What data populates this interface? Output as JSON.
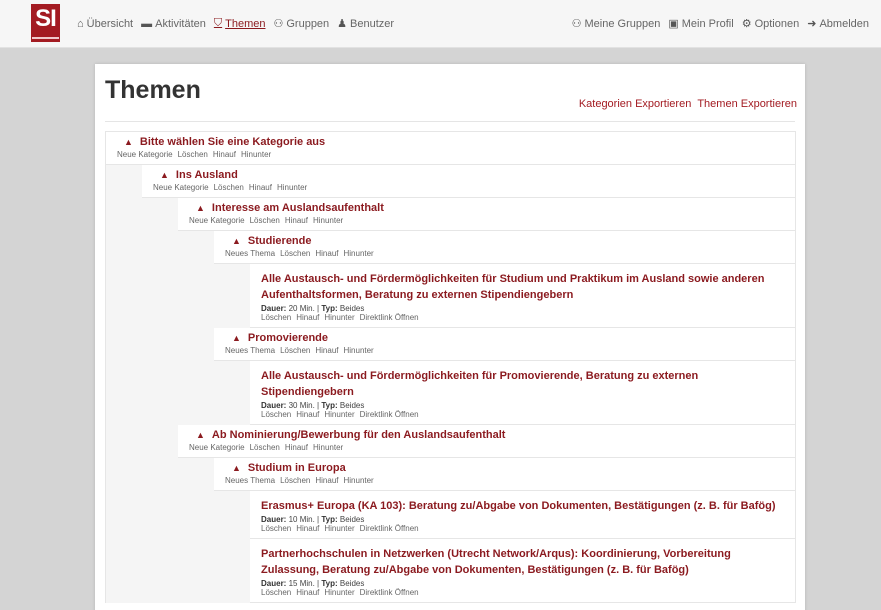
{
  "brand": {
    "logo_text": "SI"
  },
  "nav_left": [
    {
      "icon": "home-icon",
      "glyph": "⌂",
      "label": "Übersicht"
    },
    {
      "icon": "archive-icon",
      "glyph": "▬",
      "label": "Aktivitäten"
    },
    {
      "icon": "sitemap-icon",
      "glyph": "⛉",
      "label": "Themen",
      "active": true
    },
    {
      "icon": "users-icon",
      "glyph": "⚇",
      "label": "Gruppen"
    },
    {
      "icon": "user-icon",
      "glyph": "♟",
      "label": "Benutzer"
    }
  ],
  "nav_right": [
    {
      "icon": "group-icon",
      "glyph": "⚇",
      "label": "Meine Gruppen"
    },
    {
      "icon": "id-card-icon",
      "glyph": "▣",
      "label": "Mein Profil"
    },
    {
      "icon": "cogs-icon",
      "glyph": "⚙",
      "label": "Optionen"
    },
    {
      "icon": "sign-out-icon",
      "glyph": "➜",
      "label": "Abmelden"
    }
  ],
  "page": {
    "title": "Themen",
    "export_categories": "Kategorien Exportieren",
    "export_topics": "Themen Exportieren"
  },
  "labels": {
    "new_category": "Neue Kategorie",
    "new_topic": "Neues Thema",
    "delete": "Löschen",
    "up": "Hinauf",
    "down": "Hinunter",
    "direct_link": "Direktlink Öffnen",
    "duration": "Dauer:",
    "type": "Typ:"
  },
  "tree": [
    {
      "kind": "category",
      "level": 0,
      "title": "Bitte wählen Sie eine Kategorie aus",
      "new_label": "new_category"
    },
    {
      "kind": "category",
      "level": 1,
      "title": "Ins Ausland",
      "new_label": "new_category"
    },
    {
      "kind": "category",
      "level": 2,
      "title": "Interesse am Auslandsaufenthalt",
      "new_label": "new_category"
    },
    {
      "kind": "category",
      "level": 3,
      "title": "Studierende",
      "new_label": "new_topic"
    },
    {
      "kind": "topic",
      "level": 4,
      "title": "Alle Austausch- und Fördermöglichkeiten für Studium und Praktikum im Ausland sowie anderen Aufenthaltsformen, Beratung zu externen Stipendiengebern",
      "duration": "20 Min.",
      "type": "Beides"
    },
    {
      "kind": "category",
      "level": 3,
      "title": "Promovierende",
      "new_label": "new_topic"
    },
    {
      "kind": "topic",
      "level": 4,
      "title": "Alle Austausch- und Fördermöglichkeiten für Promovierende, Beratung zu externen Stipendiengebern",
      "duration": "30 Min.",
      "type": "Beides"
    },
    {
      "kind": "category",
      "level": 2,
      "title": "Ab Nominierung/Bewerbung für den Auslandsaufenthalt",
      "new_label": "new_category"
    },
    {
      "kind": "category",
      "level": 3,
      "title": "Studium in Europa",
      "new_label": "new_topic"
    },
    {
      "kind": "topic",
      "level": 4,
      "title": "Erasmus+ Europa (KA 103): Beratung zu/Abgabe von Dokumenten, Bestätigungen (z. B. für Bafög)",
      "duration": "10 Min.",
      "type": "Beides"
    },
    {
      "kind": "topic",
      "level": 4,
      "title": "Partnerhochschulen in Netzwerken (Utrecht Network/Arqus): Koordinierung, Vorbereitung Zulassung, Beratung zu/Abgabe von Dokumenten, Bestätigungen (z. B. für Bafög)",
      "duration": "15 Min.",
      "type": "Beides"
    }
  ]
}
